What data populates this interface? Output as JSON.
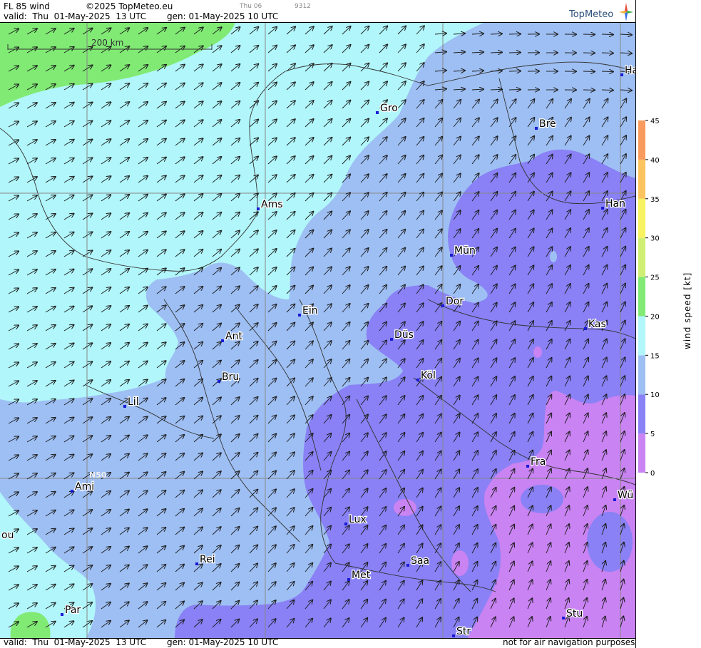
{
  "header": {
    "product": "FL 85 wind",
    "copyright": "©2025 TopMeteo.eu",
    "valid": "valid:  Thu  01-May-2025  13 UTC",
    "generated": "gen: 01-May-2025 10 UTC",
    "run_label": "Thu 06",
    "run_code": "9312"
  },
  "brand": {
    "name": "TopMeteo"
  },
  "footer": {
    "valid": "valid:  Thu  01-May-2025  13 UTC",
    "generated": "gen: 01-May-2025 10 UTC",
    "disclaimer": "not for air navigation purposes"
  },
  "map": {
    "scale_label": "200 km",
    "lat_label": "N50",
    "cities": [
      {
        "name": "Ha"
      },
      {
        "name": "Bre"
      },
      {
        "name": "Gro"
      },
      {
        "name": "Han"
      },
      {
        "name": "Ams"
      },
      {
        "name": "Mün"
      },
      {
        "name": "Ein"
      },
      {
        "name": "Dor"
      },
      {
        "name": "Kas"
      },
      {
        "name": "Ant"
      },
      {
        "name": "Düs"
      },
      {
        "name": "Bru"
      },
      {
        "name": "Köl"
      },
      {
        "name": "Lil"
      },
      {
        "name": "Fra"
      },
      {
        "name": "Ami"
      },
      {
        "name": "Wü"
      },
      {
        "name": "Lux"
      },
      {
        "name": "ou"
      },
      {
        "name": "Rei"
      },
      {
        "name": "Saa"
      },
      {
        "name": "Met"
      },
      {
        "name": "Par"
      },
      {
        "name": "Stu"
      },
      {
        "name": "Str"
      }
    ]
  },
  "legend": {
    "title": "wind speed [kt]",
    "ticks": [
      "0",
      "5",
      "10",
      "15",
      "20",
      "25",
      "30",
      "35",
      "40",
      "45"
    ],
    "colors": [
      "#c983f2",
      "#8981f5",
      "#9ebff3",
      "#b1f6fa",
      "#80ea74",
      "#cfef74",
      "#f7f25f",
      "#fcc35e",
      "#f99b5e",
      "#f17c63"
    ]
  },
  "colors": {
    "cyan": "#b1f6fa",
    "light_blue": "#9ebff3",
    "purple": "#8981f5",
    "violet": "#c983f2",
    "green": "#80ea74",
    "city_marker": "#1b1bd6"
  }
}
